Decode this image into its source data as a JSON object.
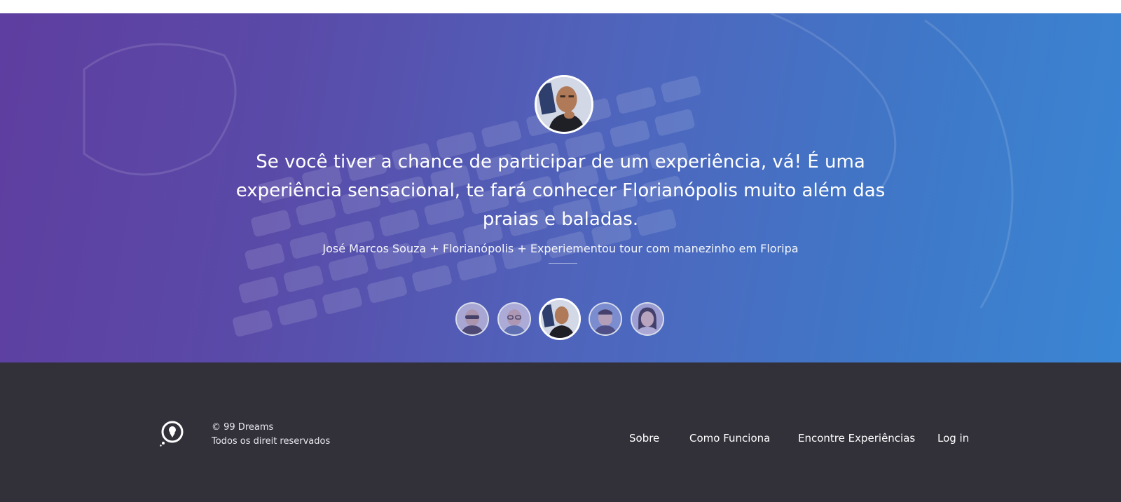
{
  "testimonial": {
    "quote": "Se você tiver a chance de participar de um experiência, vá! É uma experiência sensacional, te fará conhecer Florianópolis muito além das praias e baladas.",
    "attribution": "José Marcos Souza + Florianópolis + Experiementou tour com manezinho em Floripa",
    "active_index": 2
  },
  "footer": {
    "copyright": "© 99 Dreams",
    "rights": "Todos os direit reservados",
    "nav": {
      "sobre": "Sobre",
      "como_funciona": "Como Funciona",
      "encontre": "Encontre Experiências",
      "login": "Log in"
    }
  },
  "colors": {
    "hero_gradient_start": "#5e3ea0",
    "hero_gradient_end": "#3a86d4",
    "footer_bg": "#32313a"
  }
}
